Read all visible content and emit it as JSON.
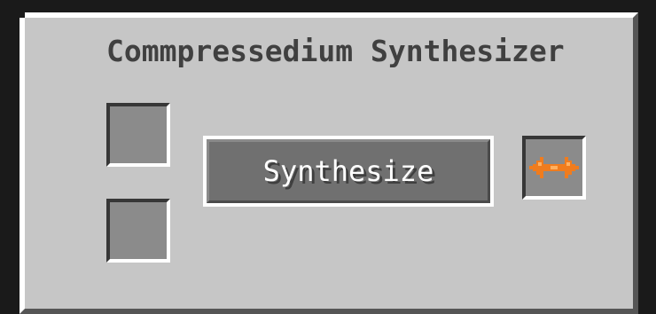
{
  "window": {
    "title": "Commpressedium Synthesizer"
  },
  "inputs": {
    "slot1_icon": "empty-slot",
    "slot2_icon": "empty-slot"
  },
  "action": {
    "button_label": "Synthesize"
  },
  "output": {
    "icon": "orange-compressed-item-icon",
    "icon_color": "#f07c1e"
  },
  "colors": {
    "panel": "#c6c6c6",
    "slot": "#8b8b8b",
    "button_face": "#707070",
    "title_text": "#404040"
  }
}
